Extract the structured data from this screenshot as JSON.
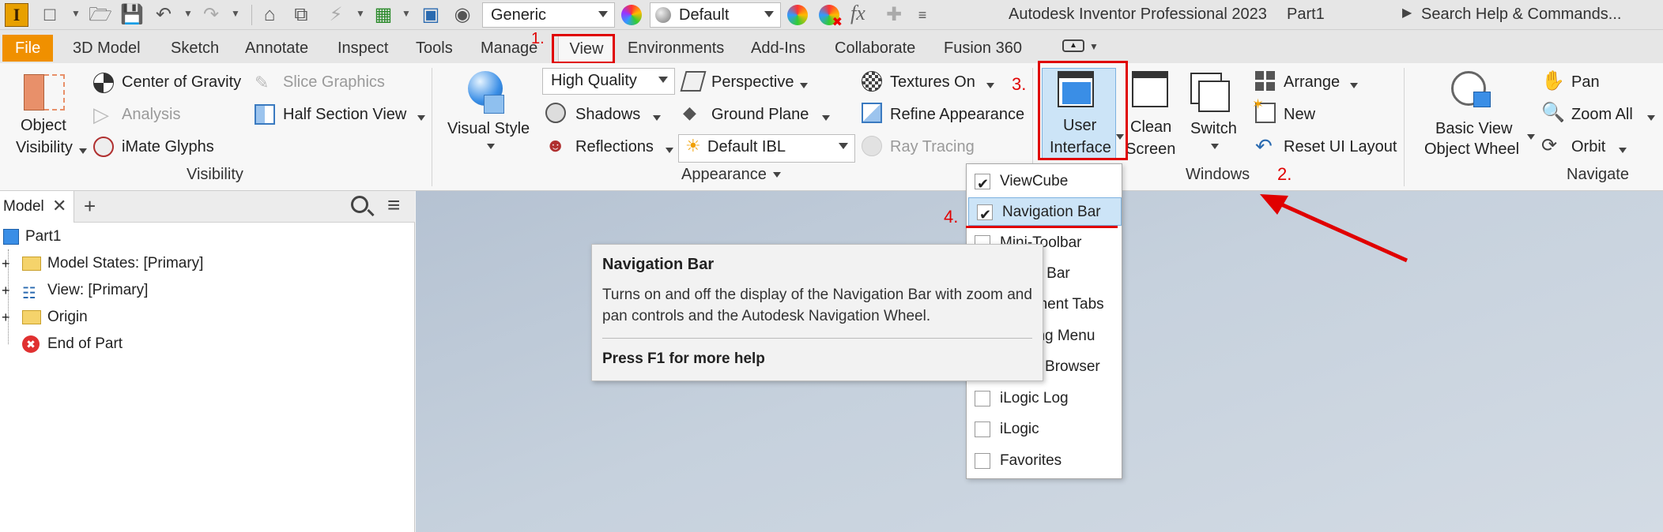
{
  "app": {
    "title": "Autodesk Inventor Professional 2023",
    "document": "Part1",
    "search_placeholder": "Search Help & Commands...",
    "logo_letter": "I"
  },
  "quick_access": {
    "material_value": "Generic",
    "appearance_value": "Default",
    "fx_label": "fx"
  },
  "tabs": [
    "File",
    "3D Model",
    "Sketch",
    "Annotate",
    "Inspect",
    "Tools",
    "Manage",
    "View",
    "Environments",
    "Add-Ins",
    "Collaborate",
    "Fusion 360"
  ],
  "active_tab": "View",
  "ribbon": {
    "visibility": {
      "label": "Visibility",
      "object_visibility_1": "Object",
      "object_visibility_2": "Visibility",
      "center_of_gravity": "Center of Gravity",
      "analysis": "Analysis",
      "imate_glyphs": "iMate Glyphs",
      "slice_graphics": "Slice Graphics",
      "half_section_view": "Half Section View"
    },
    "appearance": {
      "label": "Appearance",
      "visual_style": "Visual Style",
      "quality_value": "High Quality",
      "shadows": "Shadows",
      "reflections": "Reflections",
      "perspective": "Perspective",
      "ground_plane": "Ground Plane",
      "ibl_value": "Default IBL",
      "textures_on": "Textures On",
      "refine_appearance": "Refine Appearance",
      "ray_tracing": "Ray Tracing"
    },
    "windows": {
      "label": "Windows",
      "user_interface_1": "User",
      "user_interface_2": "Interface",
      "clean_screen_1": "Clean",
      "clean_screen_2": "Screen",
      "switch": "Switch",
      "arrange": "Arrange",
      "new": "New",
      "reset_ui_layout": "Reset UI Layout"
    },
    "navigate": {
      "label": "Navigate",
      "basic_view_1": "Basic View",
      "basic_view_2": "Object Wheel",
      "pan": "Pan",
      "zoom_all": "Zoom All",
      "orbit": "Orbit"
    }
  },
  "browser": {
    "tab_label": "Model",
    "items": [
      {
        "label": "Part1"
      },
      {
        "label": "Model States: [Primary]"
      },
      {
        "label": "View: [Primary]"
      },
      {
        "label": "Origin"
      },
      {
        "label": "End of Part"
      }
    ]
  },
  "dropdown": {
    "items": [
      {
        "label": "ViewCube",
        "checked": true
      },
      {
        "label": "Navigation Bar",
        "checked": true
      },
      {
        "label": "Mini-Toolbar",
        "checked": false
      },
      {
        "label": "Status Bar",
        "checked": false
      },
      {
        "label": "Document Tabs",
        "checked": false
      },
      {
        "label": "Marking Menu",
        "checked": false
      },
      {
        "label": "Model Browser",
        "checked": false
      },
      {
        "label": "iLogic Log",
        "checked": false
      },
      {
        "label": "iLogic",
        "checked": false
      },
      {
        "label": "Favorites",
        "checked": false
      }
    ]
  },
  "tooltip": {
    "title": "Navigation Bar",
    "body": "Turns on and off the display of the Navigation Bar with zoom and pan controls and the Autodesk Navigation Wheel.",
    "footer": "Press F1 for more help"
  },
  "annotations": {
    "step1": "1.",
    "step2": "2.",
    "step3": "3.",
    "step4": "4.",
    "color": "#e00000"
  },
  "colors": {
    "file_tab": "#f09000",
    "viewport_top": "#b5c2d2",
    "highlight": "#cce4f7"
  }
}
